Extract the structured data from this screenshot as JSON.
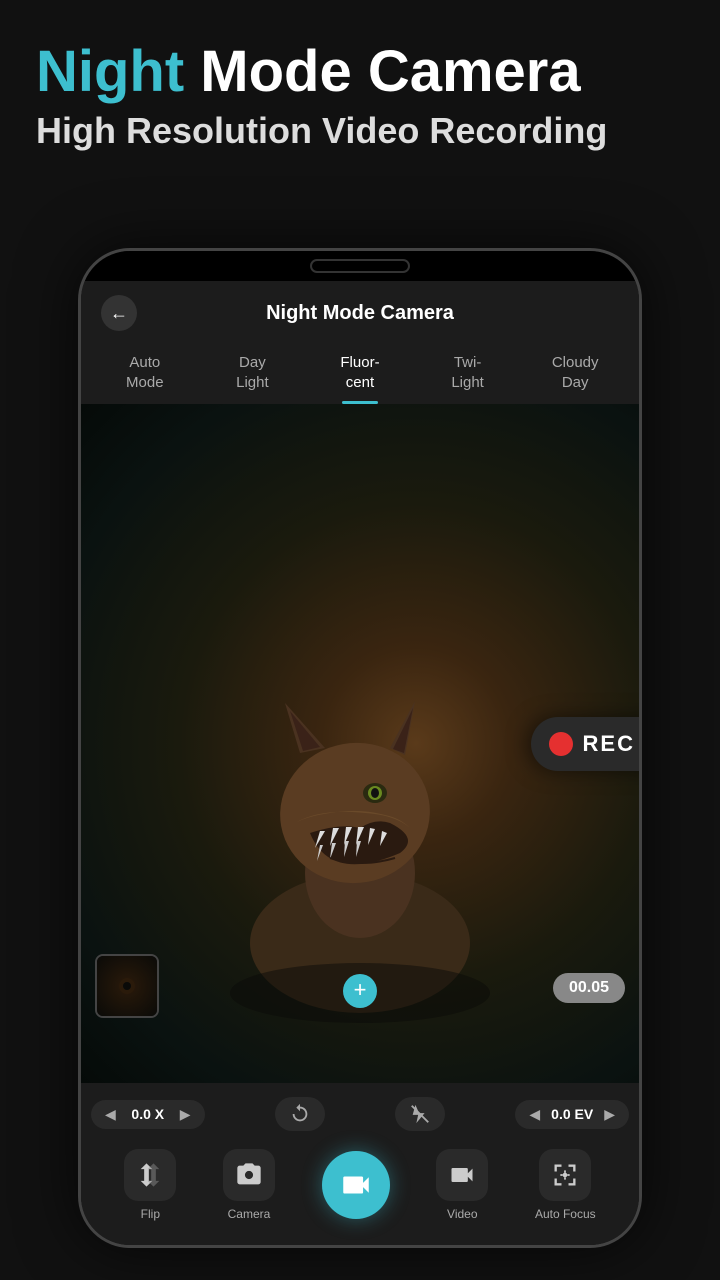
{
  "header": {
    "title_night": "Night",
    "title_rest": " Mode Camera",
    "subtitle": "High Resolution Video Recording"
  },
  "camera": {
    "back_label": "←",
    "title": "Night Mode Camera",
    "tabs": [
      {
        "label": "Auto\nMode",
        "active": false,
        "id": "auto"
      },
      {
        "label": "Day\nLight",
        "active": false,
        "id": "daylight"
      },
      {
        "label": "Fluor-\ncent",
        "active": true,
        "id": "fluorescent"
      },
      {
        "label": "Twi-\nLight",
        "active": false,
        "id": "twilight"
      },
      {
        "label": "Cloudy\nDay",
        "active": false,
        "id": "cloudyday"
      }
    ],
    "rec_label": "REC",
    "timer": "00.05",
    "zoom_value": "0.0 X",
    "ev_value": "0.0 EV",
    "buttons": [
      {
        "label": "Flip",
        "id": "flip"
      },
      {
        "label": "Camera",
        "id": "camera"
      },
      {
        "label": "",
        "id": "record"
      },
      {
        "label": "Video",
        "id": "video"
      },
      {
        "label": "Auto Focus",
        "id": "autofocus"
      }
    ]
  },
  "colors": {
    "accent": "#3dbfcf",
    "rec_red": "#e53030",
    "bg_dark": "#111111",
    "phone_bg": "#1c1c1c"
  }
}
